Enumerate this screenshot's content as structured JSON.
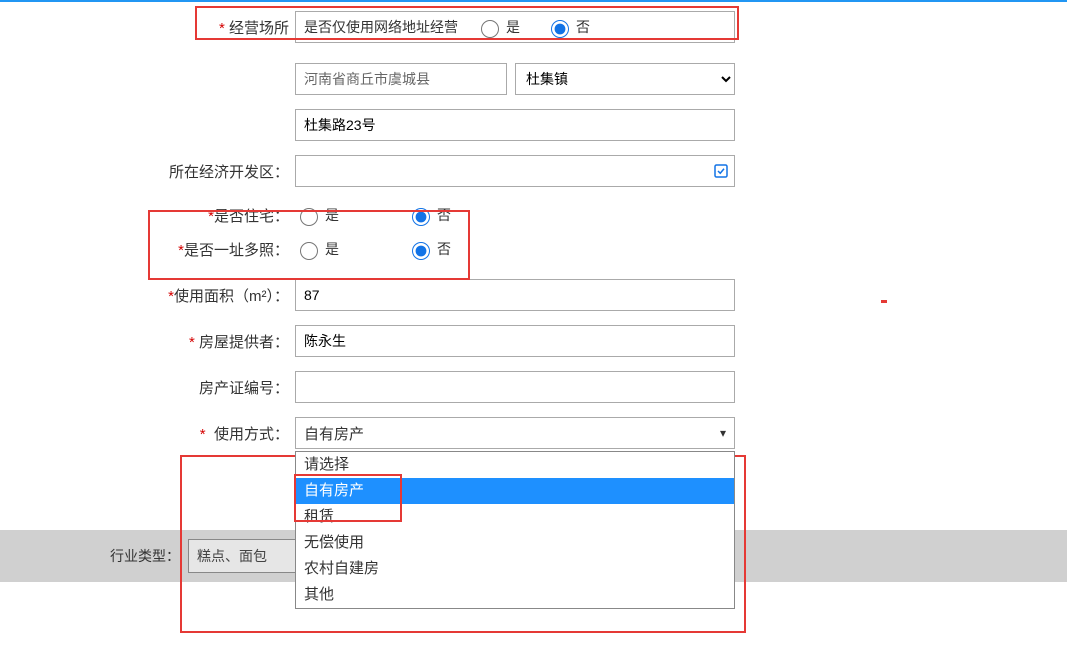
{
  "row_business_place": {
    "label": "经营场所",
    "prompt": "是否仅使用网络地址经营",
    "yes": "是",
    "no": "否",
    "value": "no"
  },
  "row_region": {
    "readonly_value": "河南省商丘市虞城县",
    "select_options": [
      "杜集镇"
    ],
    "selected": "杜集镇"
  },
  "row_address": {
    "value": "杜集路23号"
  },
  "row_econ_zone": {
    "label": "所在经济开发区：",
    "value": ""
  },
  "row_residence": {
    "label": "是否住宅：",
    "yes": "是",
    "no": "否",
    "value": "no"
  },
  "row_multi_license": {
    "label": "是否一址多照：",
    "yes": "是",
    "no": "否",
    "value": "no"
  },
  "row_area": {
    "label": "使用面积（m²）：",
    "value": "87"
  },
  "row_provider": {
    "label": "房屋提供者：",
    "value": "陈永生"
  },
  "row_cert_no": {
    "label": "房产证编号：",
    "value": ""
  },
  "row_usage": {
    "label": "使用方式：",
    "selected": "自有房产",
    "options": [
      "请选择",
      "自有房产",
      "租赁",
      "无偿使用",
      "农村自建房",
      "其他"
    ]
  },
  "row_industry": {
    "label": "行业类型：",
    "value": "糕点、面包"
  },
  "required_mark": "*"
}
